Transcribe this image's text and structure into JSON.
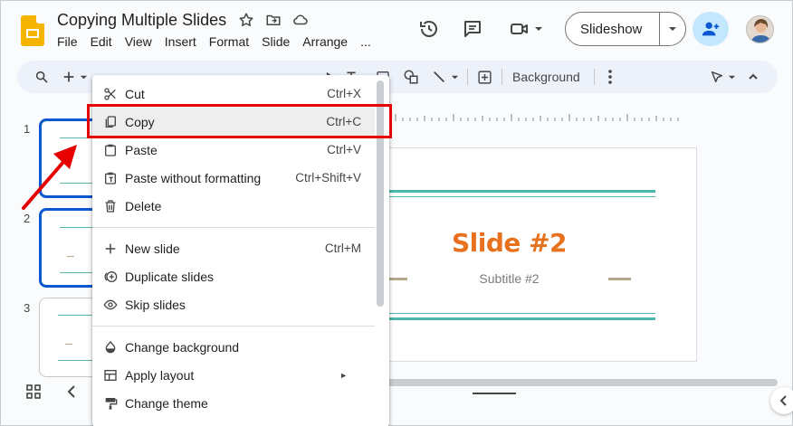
{
  "document": {
    "title": "Copying Multiple Slides"
  },
  "menubar": [
    "File",
    "Edit",
    "View",
    "Insert",
    "Format",
    "Slide",
    "Arrange",
    "..."
  ],
  "header": {
    "slideshow_label": "Slideshow"
  },
  "toolbar": {
    "background_label": "Background"
  },
  "filmstrip": {
    "slides": [
      {
        "number": "1"
      },
      {
        "number": "2"
      },
      {
        "number": "3"
      }
    ]
  },
  "slide": {
    "title": "Slide #2",
    "subtitle": "Subtitle #2"
  },
  "context_menu": {
    "items": [
      {
        "label": "Cut",
        "shortcut": "Ctrl+X",
        "icon": "scissors-icon"
      },
      {
        "label": "Copy",
        "shortcut": "Ctrl+C",
        "icon": "copy-icon"
      },
      {
        "label": "Paste",
        "shortcut": "Ctrl+V",
        "icon": "clipboard-icon"
      },
      {
        "label": "Paste without formatting",
        "shortcut": "Ctrl+Shift+V",
        "icon": "clipboard-text-icon"
      },
      {
        "label": "Delete",
        "shortcut": "",
        "icon": "trash-icon"
      },
      {
        "label": "New slide",
        "shortcut": "Ctrl+M",
        "icon": "plus-icon"
      },
      {
        "label": "Duplicate slides",
        "shortcut": "",
        "icon": "duplicate-icon"
      },
      {
        "label": "Skip slides",
        "shortcut": "",
        "icon": "eye-icon"
      },
      {
        "label": "Change background",
        "shortcut": "",
        "icon": "paint-drop-icon"
      },
      {
        "label": "Apply layout",
        "shortcut": "",
        "icon": "layout-icon"
      },
      {
        "label": "Change theme",
        "shortcut": "",
        "icon": "paint-roller-icon"
      }
    ]
  },
  "colors": {
    "accent_blue": "#0b57d0",
    "highlight_red": "#e60000",
    "slide_title_orange": "#e8711d",
    "slide_line_teal": "#4db6ac"
  }
}
